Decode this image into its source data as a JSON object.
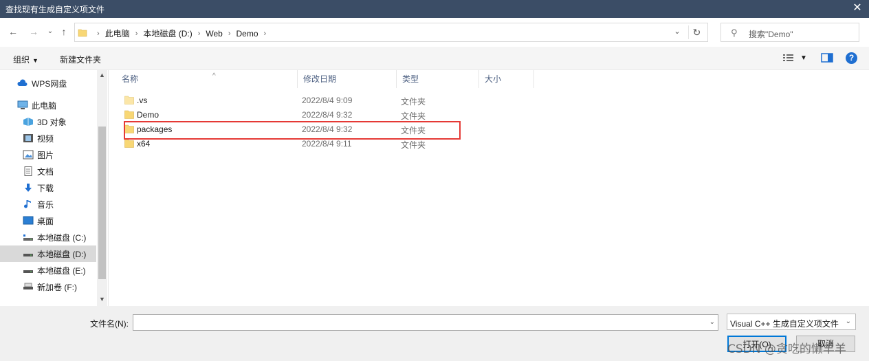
{
  "window": {
    "title": "查找现有生成自定义项文件",
    "close_glyph": "✕"
  },
  "address": {
    "crumbs": [
      "此电脑",
      "本地磁盘 (D:)",
      "Web",
      "Demo"
    ]
  },
  "search": {
    "placeholder": "搜索\"Demo\""
  },
  "toolbar": {
    "organize": "组织",
    "new_folder": "新建文件夹",
    "help": "?"
  },
  "nav": {
    "items": [
      {
        "label": "WPS网盘",
        "icon": "cloud-icon"
      },
      {
        "label": "此电脑",
        "icon": "computer-icon"
      },
      {
        "label": "3D 对象",
        "icon": "3d-objects-icon"
      },
      {
        "label": "视频",
        "icon": "video-icon"
      },
      {
        "label": "图片",
        "icon": "pictures-icon"
      },
      {
        "label": "文档",
        "icon": "documents-icon"
      },
      {
        "label": "下载",
        "icon": "download-icon"
      },
      {
        "label": "音乐",
        "icon": "music-icon"
      },
      {
        "label": "桌面",
        "icon": "desktop-icon"
      },
      {
        "label": "本地磁盘 (C:)",
        "icon": "drive-icon"
      },
      {
        "label": "本地磁盘 (D:)",
        "icon": "drive-icon",
        "selected": true
      },
      {
        "label": "本地磁盘 (E:)",
        "icon": "drive-icon"
      },
      {
        "label": "新加卷 (F:)",
        "icon": "drive-icon"
      }
    ]
  },
  "columns": [
    "名称",
    "修改日期",
    "类型",
    "大小"
  ],
  "files": [
    {
      "name": ".vs",
      "modified": "2022/8/4 9:09",
      "type": "文件夹"
    },
    {
      "name": "Demo",
      "modified": "2022/8/4 9:32",
      "type": "文件夹"
    },
    {
      "name": "packages",
      "modified": "2022/8/4 9:32",
      "type": "文件夹"
    },
    {
      "name": "x64",
      "modified": "2022/8/4 9:11",
      "type": "文件夹"
    }
  ],
  "bottom": {
    "filename_label": "文件名(N):",
    "filename_value": "",
    "filter": "Visual C++ 生成自定义项文件",
    "open_button": "打开(O)",
    "cancel_button": "取消",
    "watermark": "CSDN @贪吃的懒羊羊"
  },
  "colors": {
    "title_bg": "#3b4d66",
    "folder": "#f8d775",
    "accent": "#0078d7",
    "highlight_border": "#e53935"
  }
}
